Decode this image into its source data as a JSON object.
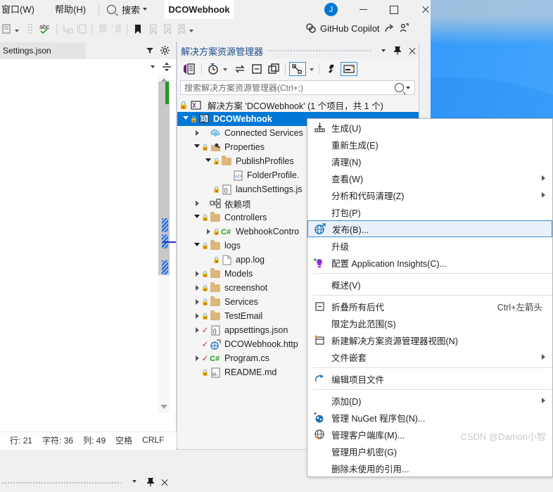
{
  "titlebar": {
    "menus": [
      {
        "label": "窗口(W)",
        "name": "menu-window"
      },
      {
        "label": "帮助(H)",
        "name": "menu-help"
      }
    ],
    "search_label": "搜索",
    "project_tab": "DCOWebhook",
    "avatar_initial": "J",
    "window_controls": {
      "minimize": "最小化",
      "maximize": "最大化",
      "close": "关闭"
    }
  },
  "toolbar": {
    "copilot_label": "GitHub Copilot"
  },
  "editor": {
    "tab_label": "Settings.json",
    "status": {
      "line_label": "行:",
      "line_value": "21",
      "char_label": "字符:",
      "char_value": "36",
      "col_label": "列:",
      "col_value": "49",
      "spacing": "空格",
      "eol": "CRLF"
    }
  },
  "solution_explorer": {
    "title": "解决方案资源管理器",
    "search_placeholder": "搜索解决方案资源管理器(Ctrl+;)",
    "solution_line": "解决方案 'DCOWebhook' (1 个项目，共 1 个)",
    "tree": [
      {
        "label": "DCOWebhook",
        "indent": 0,
        "arrow": "open",
        "lock": true,
        "icon": "web-project-icon",
        "selected": true
      },
      {
        "label": "Connected Services",
        "indent": 1,
        "arrow": "closed",
        "lock": false,
        "icon": "connected-services-icon"
      },
      {
        "label": "Properties",
        "indent": 1,
        "arrow": "open",
        "lock": true,
        "icon": "properties-icon"
      },
      {
        "label": "PublishProfiles",
        "indent": 2,
        "arrow": "open",
        "lock": true,
        "icon": "folder-icon"
      },
      {
        "label": "FolderProfile.",
        "indent": 3,
        "arrow": "none",
        "lock": false,
        "icon": "xml-file-icon"
      },
      {
        "label": "launchSettings.js",
        "indent": 2,
        "arrow": "none",
        "lock": true,
        "icon": "json-file-icon"
      },
      {
        "label": "依赖项",
        "indent": 1,
        "arrow": "closed",
        "lock": false,
        "icon": "dependencies-icon"
      },
      {
        "label": "Controllers",
        "indent": 1,
        "arrow": "open",
        "lock": true,
        "icon": "folder-icon"
      },
      {
        "label": "WebhookContro",
        "indent": 2,
        "arrow": "closed",
        "lock": true,
        "icon": "csharp-file-icon"
      },
      {
        "label": "logs",
        "indent": 1,
        "arrow": "open",
        "lock": true,
        "icon": "folder-icon"
      },
      {
        "label": "app.log",
        "indent": 2,
        "arrow": "none",
        "lock": true,
        "icon": "text-file-icon"
      },
      {
        "label": "Models",
        "indent": 1,
        "arrow": "closed",
        "lock": true,
        "icon": "folder-icon"
      },
      {
        "label": "screenshot",
        "indent": 1,
        "arrow": "closed",
        "lock": true,
        "icon": "folder-icon"
      },
      {
        "label": "Services",
        "indent": 1,
        "arrow": "closed",
        "lock": true,
        "icon": "folder-icon"
      },
      {
        "label": "TestEmail",
        "indent": 1,
        "arrow": "closed",
        "lock": true,
        "icon": "folder-icon"
      },
      {
        "label": "appsettings.json",
        "indent": 1,
        "arrow": "closed",
        "check": true,
        "icon": "json-file-icon"
      },
      {
        "label": "DCOWebhook.http",
        "indent": 1,
        "arrow": "none",
        "check": true,
        "icon": "http-file-icon"
      },
      {
        "label": "Program.cs",
        "indent": 1,
        "arrow": "closed",
        "check": true,
        "icon": "csharp-file-icon"
      },
      {
        "label": "README.md",
        "indent": 1,
        "arrow": "none",
        "lock": true,
        "icon": "markdown-file-icon"
      }
    ]
  },
  "context_menu": {
    "items": [
      {
        "label": "生成(U)",
        "icon": "build-icon"
      },
      {
        "label": "重新生成(E)",
        "icon": null
      },
      {
        "label": "清理(N)",
        "icon": null
      },
      {
        "label": "查看(W)",
        "icon": null,
        "submenu": true
      },
      {
        "label": "分析和代码清理(Z)",
        "icon": null,
        "submenu": true
      },
      {
        "label": "打包(P)",
        "icon": null
      },
      {
        "label": "发布(B)...",
        "icon": "publish-globe-icon",
        "highlighted": true
      },
      {
        "label": "升级",
        "icon": null
      },
      {
        "label": "配置 Application Insights(C)...",
        "icon": "app-insights-icon"
      },
      {
        "separator": true
      },
      {
        "label": "概述(V)",
        "icon": null
      },
      {
        "separator": true
      },
      {
        "label": "折叠所有后代",
        "icon": "collapse-icon",
        "shortcut": "Ctrl+左箭头"
      },
      {
        "label": "限定为此范围(S)",
        "icon": null
      },
      {
        "label": "新建解决方案资源管理器视图(N)",
        "icon": "new-view-icon"
      },
      {
        "label": "文件嵌套",
        "icon": null,
        "submenu": true
      },
      {
        "separator": true
      },
      {
        "label": "编辑项目文件",
        "icon": "edit-project-icon"
      },
      {
        "separator": true
      },
      {
        "label": "添加(D)",
        "icon": null,
        "submenu": true
      },
      {
        "label": "管理 NuGet 程序包(N)...",
        "icon": "nuget-icon"
      },
      {
        "label": "管理客户端库(M)...",
        "icon": "client-libraries-icon"
      },
      {
        "label": "管理用户机密(G)",
        "icon": null
      },
      {
        "label": "删除未使用的引用...",
        "icon": null
      }
    ]
  },
  "watermark": "CSDN @Damon小智",
  "colors": {
    "accent": "#0078d7",
    "title_text": "#1b4c8c",
    "highlight_bg": "#e8f1fb",
    "highlight_border": "#3f8fd0",
    "folder": "#dcb67a",
    "check": "#c0392b"
  }
}
